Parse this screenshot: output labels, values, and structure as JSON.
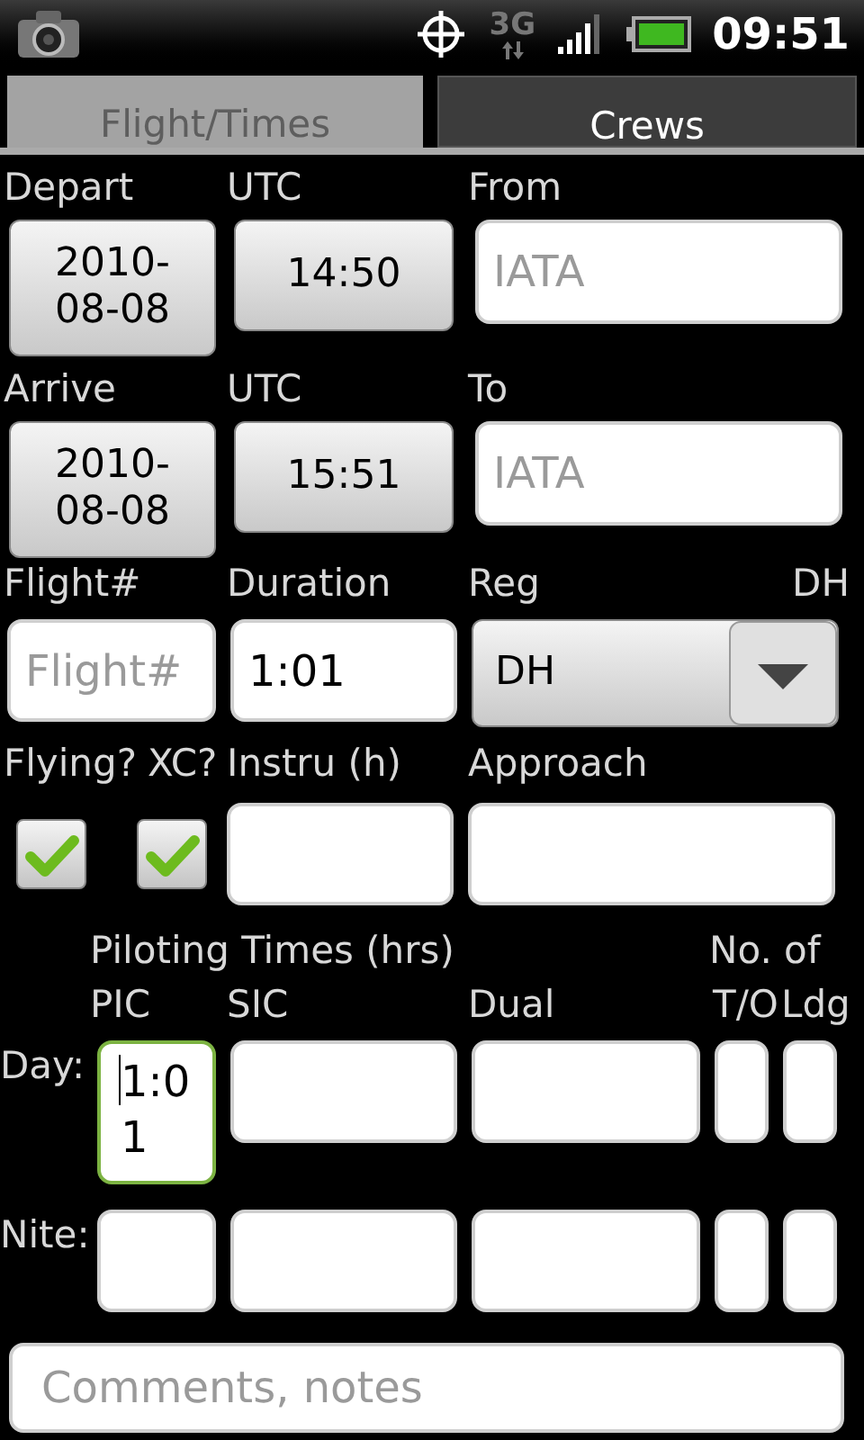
{
  "status_bar": {
    "network": "3G",
    "time": "09:51"
  },
  "tabs": [
    {
      "label": "Flight/Times",
      "selected": true
    },
    {
      "label": "Crews",
      "selected": false
    }
  ],
  "legs": [
    {
      "label": "Depart",
      "tz": "UTC",
      "date": "2010-08-08",
      "time": "14:50",
      "place_label": "From",
      "place_placeholder": "IATA"
    },
    {
      "label": "Arrive",
      "tz": "UTC",
      "date": "2010-08-08",
      "time": "15:51",
      "place_label": "To",
      "place_placeholder": "IATA"
    }
  ],
  "flight": {
    "number_label": "Flight#",
    "number_placeholder": "Flight#",
    "duration_label": "Duration",
    "duration": "1:01",
    "reg_label": "Reg",
    "dh_label": "DH",
    "reg_value": "DH"
  },
  "checks": [
    {
      "label": "Flying?",
      "checked": true
    },
    {
      "label": "XC?",
      "checked": true
    }
  ],
  "instru_label": "Instru (h)",
  "approach_label": "Approach",
  "piloting": {
    "title": "Piloting Times (hrs)",
    "count_title": "No. of",
    "columns": [
      "PIC",
      "SIC",
      "Dual",
      "T/O",
      "Ldg"
    ],
    "rows": [
      {
        "label": "Day:",
        "cells": [
          {
            "value": "1:01",
            "focused": true
          },
          {
            "focused": false
          },
          {
            "focused": false
          },
          {
            "focused": false
          },
          {
            "focused": false
          }
        ]
      },
      {
        "label": "Nite:",
        "cells": [
          {
            "focused": false
          },
          {
            "focused": false
          },
          {
            "focused": false
          },
          {
            "focused": false
          },
          {
            "focused": false
          }
        ]
      }
    ]
  },
  "comments": {
    "placeholder": "Comments, notes"
  }
}
